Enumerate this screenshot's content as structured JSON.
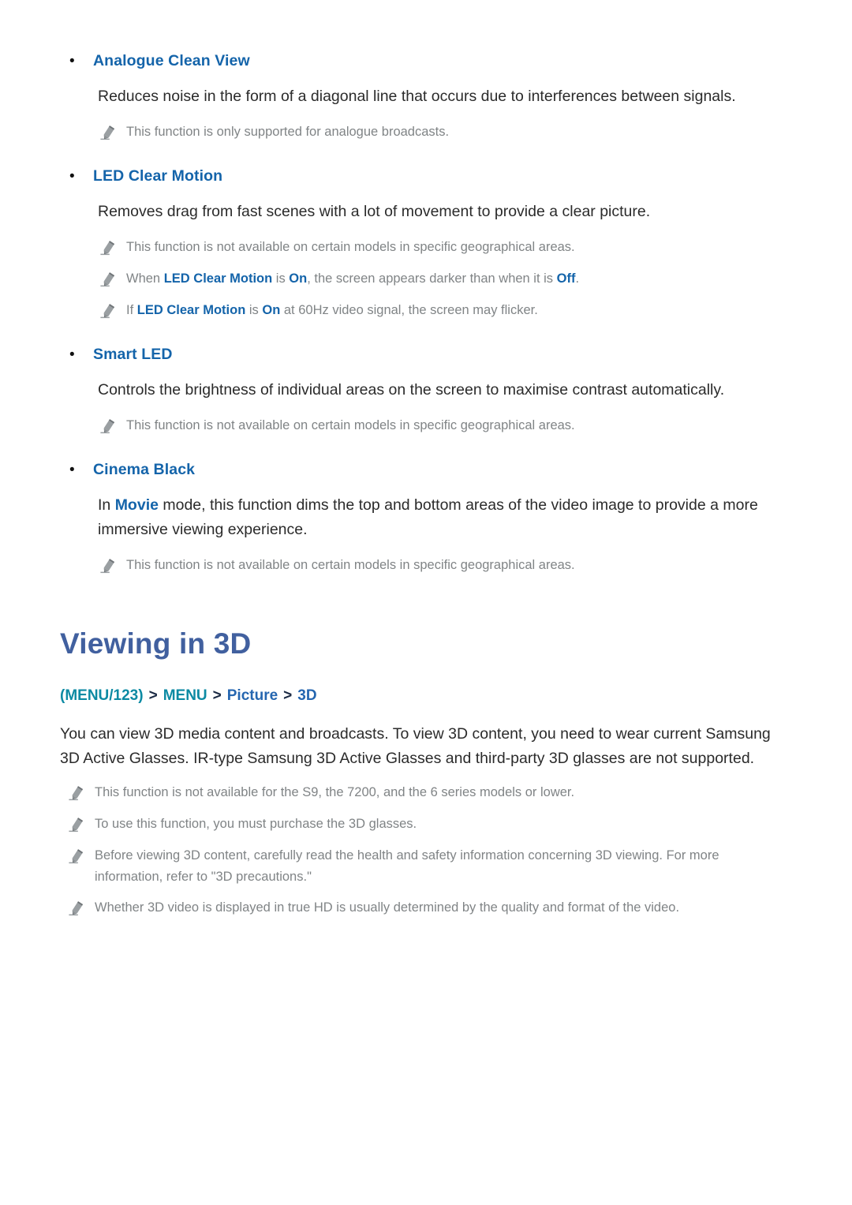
{
  "document": {
    "sections": [
      {
        "id": "analogue-clean-view",
        "bullet_label": "Analogue Clean View",
        "body": "Reduces noise in the form of a diagonal line that occurs due to interferences between signals.",
        "notes": [
          {
            "text": "This function is only supported for analogue broadcasts."
          }
        ]
      },
      {
        "id": "led-clear-motion",
        "bullet_label": "LED Clear Motion",
        "body": "Removes drag from fast scenes with a lot of movement to provide a clear picture.",
        "notes": [
          {
            "text": "This function is not available on certain models in specific geographical areas."
          },
          {
            "parts": [
              {
                "text": "When ",
                "style": "plain"
              },
              {
                "text": "LED Clear Motion",
                "style": "term"
              },
              {
                "text": " is ",
                "style": "plain"
              },
              {
                "text": "On",
                "style": "term"
              },
              {
                "text": ", the screen appears darker than when it is ",
                "style": "plain"
              },
              {
                "text": "Off",
                "style": "term"
              },
              {
                "text": ".",
                "style": "plain"
              }
            ]
          },
          {
            "parts": [
              {
                "text": "If ",
                "style": "plain"
              },
              {
                "text": "LED Clear Motion",
                "style": "term"
              },
              {
                "text": " is ",
                "style": "plain"
              },
              {
                "text": "On",
                "style": "term"
              },
              {
                "text": " at 60Hz video signal, the screen may flicker.",
                "style": "plain"
              }
            ]
          }
        ]
      },
      {
        "id": "smart-led",
        "bullet_label": "Smart LED",
        "body": "Controls the brightness of individual areas on the screen to maximise contrast automatically.",
        "notes": [
          {
            "text": "This function is not available on certain models in specific geographical areas."
          }
        ]
      },
      {
        "id": "cinema-black",
        "bullet_label": "Cinema Black",
        "body_parts": [
          {
            "text": "In ",
            "style": "plain"
          },
          {
            "text": "Movie",
            "style": "term"
          },
          {
            "text": " mode, this function dims the top and bottom areas of the video image to provide a more immersive viewing experience.",
            "style": "plain"
          }
        ],
        "notes": [
          {
            "text": "This function is not available on certain models in specific geographical areas."
          }
        ]
      }
    ],
    "chapter": {
      "title": "Viewing in 3D",
      "breadcrumb": [
        {
          "text": "(MENU/123)",
          "style": "teal"
        },
        {
          "text": ">",
          "style": "arrow"
        },
        {
          "text": "MENU",
          "style": "teal"
        },
        {
          "text": ">",
          "style": "arrow"
        },
        {
          "text": "Picture",
          "style": "blue"
        },
        {
          "text": ">",
          "style": "arrow"
        },
        {
          "text": "3D",
          "style": "blue"
        }
      ],
      "intro": "You can view 3D media content and broadcasts. To view 3D content, you need to wear current Samsung 3D Active Glasses. IR-type Samsung 3D Active Glasses and third-party 3D glasses are not supported.",
      "notes": [
        {
          "text": "This function is not available for the S9, the 7200, and the 6 series models or lower."
        },
        {
          "text": "To use this function, you must purchase the 3D glasses."
        },
        {
          "text": "Before viewing 3D content, carefully read the health and safety information concerning 3D viewing. For more information, refer to \"3D precautions.\""
        },
        {
          "text": "Whether 3D video is displayed in true HD is usually determined by the quality and format of the video."
        }
      ]
    }
  },
  "colors": {
    "heading_blue": "#1464aa",
    "title_indigo": "#41609f",
    "breadcrumb_teal": "#0c8aa3",
    "breadcrumb_blue": "#2566b0",
    "note_gray": "#808486",
    "body_text": "#2b2b2b"
  },
  "icons": {
    "note": "pencil-icon",
    "bullet": "bullet-dot-icon",
    "breadcrumb_separator": "chevron-right-icon"
  }
}
